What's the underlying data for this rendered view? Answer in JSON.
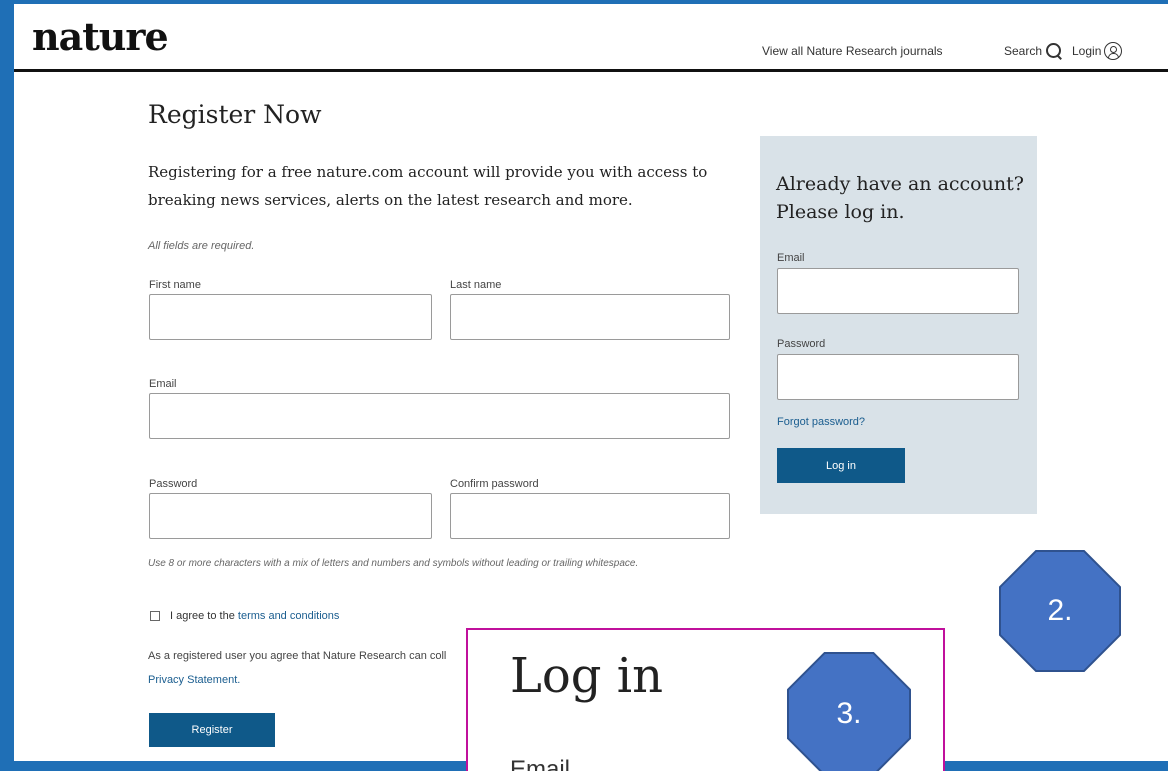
{
  "header": {
    "logo": "nature",
    "journals_link": "View all Nature Research journals",
    "search_label": "Search",
    "login_label": "Login"
  },
  "register": {
    "title": "Register Now",
    "intro": "Registering for a free nature.com account will provide you with access to breaking news services, alerts on the latest research and more.",
    "required_note": "All fields are required.",
    "first_name_label": "First name",
    "last_name_label": "Last name",
    "email_label": "Email",
    "password_label": "Password",
    "confirm_password_label": "Confirm password",
    "password_hint": "Use 8 or more characters with a mix of letters and numbers and symbols without leading or trailing whitespace.",
    "agree_prefix": "I agree to the",
    "terms_link": "terms and conditions",
    "notice_text": "As a registered user you agree that Nature Research can coll",
    "privacy_link": "Privacy Statement.",
    "register_button": "Register"
  },
  "login_panel": {
    "title": "Already have an account? Please log in.",
    "email_label": "Email",
    "password_label": "Password",
    "forgot_link": "Forgot password?",
    "login_button": "Log in"
  },
  "annotations": {
    "marker_2": "2.",
    "marker_3": "3.",
    "color": "#4472c4",
    "zoom_border_color": "#c0109c"
  },
  "zoom_inset": {
    "title": "Log in",
    "email_label": "Email"
  }
}
